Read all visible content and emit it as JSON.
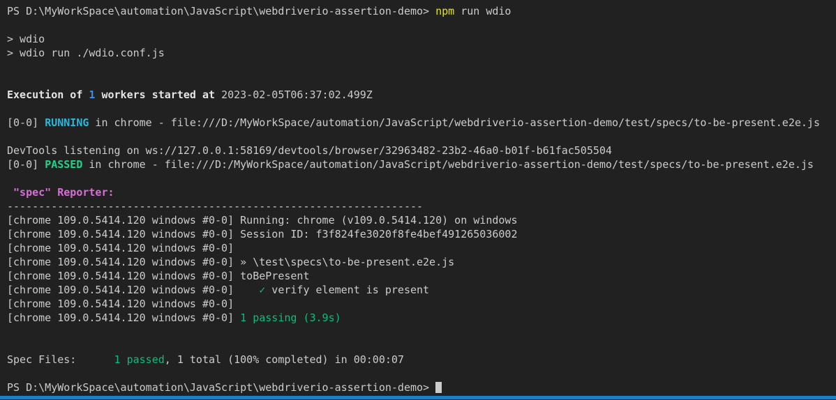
{
  "palette": {
    "background": "#212121",
    "foreground": "#cccccc",
    "cursor": "#cccccc",
    "statusbar_blue": "#1b80c4",
    "bottom_edge": "#161616"
  },
  "styles": {
    "fg": {
      "color": "#cccccc",
      "bold": false
    },
    "white-bold": {
      "color": "#e5e5e5",
      "bold": true
    },
    "yellow": {
      "color": "#e5e510",
      "bold": false
    },
    "blue-bold": {
      "color": "#3b8eea",
      "bold": true
    },
    "cyan-bold": {
      "color": "#29b8db",
      "bold": true
    },
    "green-bold": {
      "color": "#23d18b",
      "bold": true
    },
    "green": {
      "color": "#0dbc79",
      "bold": false
    },
    "magenta-bold": {
      "color": "#d670d6",
      "bold": true
    }
  },
  "terminal": {
    "lines": [
      {
        "segments": [
          {
            "text": "PS D:\\MyWorkSpace\\automation\\JavaScript\\webdriverio-assertion-demo> ",
            "style": "fg"
          },
          {
            "text": "npm",
            "style": "yellow"
          },
          {
            "text": " run wdio",
            "style": "fg"
          }
        ]
      },
      {
        "segments": []
      },
      {
        "segments": [
          {
            "text": "> wdio",
            "style": "fg"
          }
        ]
      },
      {
        "segments": [
          {
            "text": "> wdio run ./wdio.conf.js",
            "style": "fg"
          }
        ]
      },
      {
        "segments": []
      },
      {
        "segments": []
      },
      {
        "segments": [
          {
            "text": "Execution of ",
            "style": "white-bold"
          },
          {
            "text": "1",
            "style": "blue-bold"
          },
          {
            "text": " workers started at ",
            "style": "white-bold"
          },
          {
            "text": "2023-02-05T06:37:02.499Z",
            "style": "fg"
          }
        ]
      },
      {
        "segments": []
      },
      {
        "segments": [
          {
            "text": "[0-0] ",
            "style": "fg"
          },
          {
            "text": "RUNNING",
            "style": "cyan-bold"
          },
          {
            "text": " in chrome - file:///D:/MyWorkSpace/automation/JavaScript/webdriverio-assertion-demo/test/specs/to-be-present.e2e.js",
            "style": "fg"
          }
        ]
      },
      {
        "segments": []
      },
      {
        "segments": [
          {
            "text": "DevTools listening on ws://127.0.0.1:58169/devtools/browser/32963482-23b2-46a0-b01f-b61fac505504",
            "style": "fg"
          }
        ]
      },
      {
        "segments": [
          {
            "text": "[0-0] ",
            "style": "fg"
          },
          {
            "text": "PASSED",
            "style": "green-bold"
          },
          {
            "text": " in chrome - file:///D:/MyWorkSpace/automation/JavaScript/webdriverio-assertion-demo/test/specs/to-be-present.e2e.js",
            "style": "fg"
          }
        ]
      },
      {
        "segments": []
      },
      {
        "segments": [
          {
            "text": " \"spec\" Reporter:",
            "style": "magenta-bold"
          }
        ]
      },
      {
        "segments": [
          {
            "text": "------------------------------------------------------------------",
            "style": "fg"
          }
        ]
      },
      {
        "segments": [
          {
            "text": "[chrome 109.0.5414.120 windows #0-0] Running: chrome (v109.0.5414.120) on windows",
            "style": "fg"
          }
        ]
      },
      {
        "segments": [
          {
            "text": "[chrome 109.0.5414.120 windows #0-0] Session ID: f3f824fe3020f8fe4bef491265036002",
            "style": "fg"
          }
        ]
      },
      {
        "segments": [
          {
            "text": "[chrome 109.0.5414.120 windows #0-0]",
            "style": "fg"
          }
        ]
      },
      {
        "segments": [
          {
            "text": "[chrome 109.0.5414.120 windows #0-0] » \\test\\specs\\to-be-present.e2e.js",
            "style": "fg"
          }
        ]
      },
      {
        "segments": [
          {
            "text": "[chrome 109.0.5414.120 windows #0-0] toBePresent",
            "style": "fg"
          }
        ]
      },
      {
        "segments": [
          {
            "text": "[chrome 109.0.5414.120 windows #0-0]    ",
            "style": "fg"
          },
          {
            "text": "✓",
            "style": "green"
          },
          {
            "text": " verify element is present",
            "style": "fg"
          }
        ]
      },
      {
        "segments": [
          {
            "text": "[chrome 109.0.5414.120 windows #0-0]",
            "style": "fg"
          }
        ]
      },
      {
        "segments": [
          {
            "text": "[chrome 109.0.5414.120 windows #0-0] ",
            "style": "fg"
          },
          {
            "text": "1 passing (3.9s)",
            "style": "green"
          }
        ]
      },
      {
        "segments": []
      },
      {
        "segments": []
      },
      {
        "segments": [
          {
            "text": "Spec Files:      ",
            "style": "fg"
          },
          {
            "text": "1 passed",
            "style": "green"
          },
          {
            "text": ", 1 total (100% completed) in 00:00:07",
            "style": "fg"
          }
        ]
      },
      {
        "segments": []
      },
      {
        "segments": [
          {
            "text": "PS D:\\MyWorkSpace\\automation\\JavaScript\\webdriverio-assertion-demo> ",
            "style": "fg"
          }
        ],
        "cursor": true
      }
    ]
  }
}
